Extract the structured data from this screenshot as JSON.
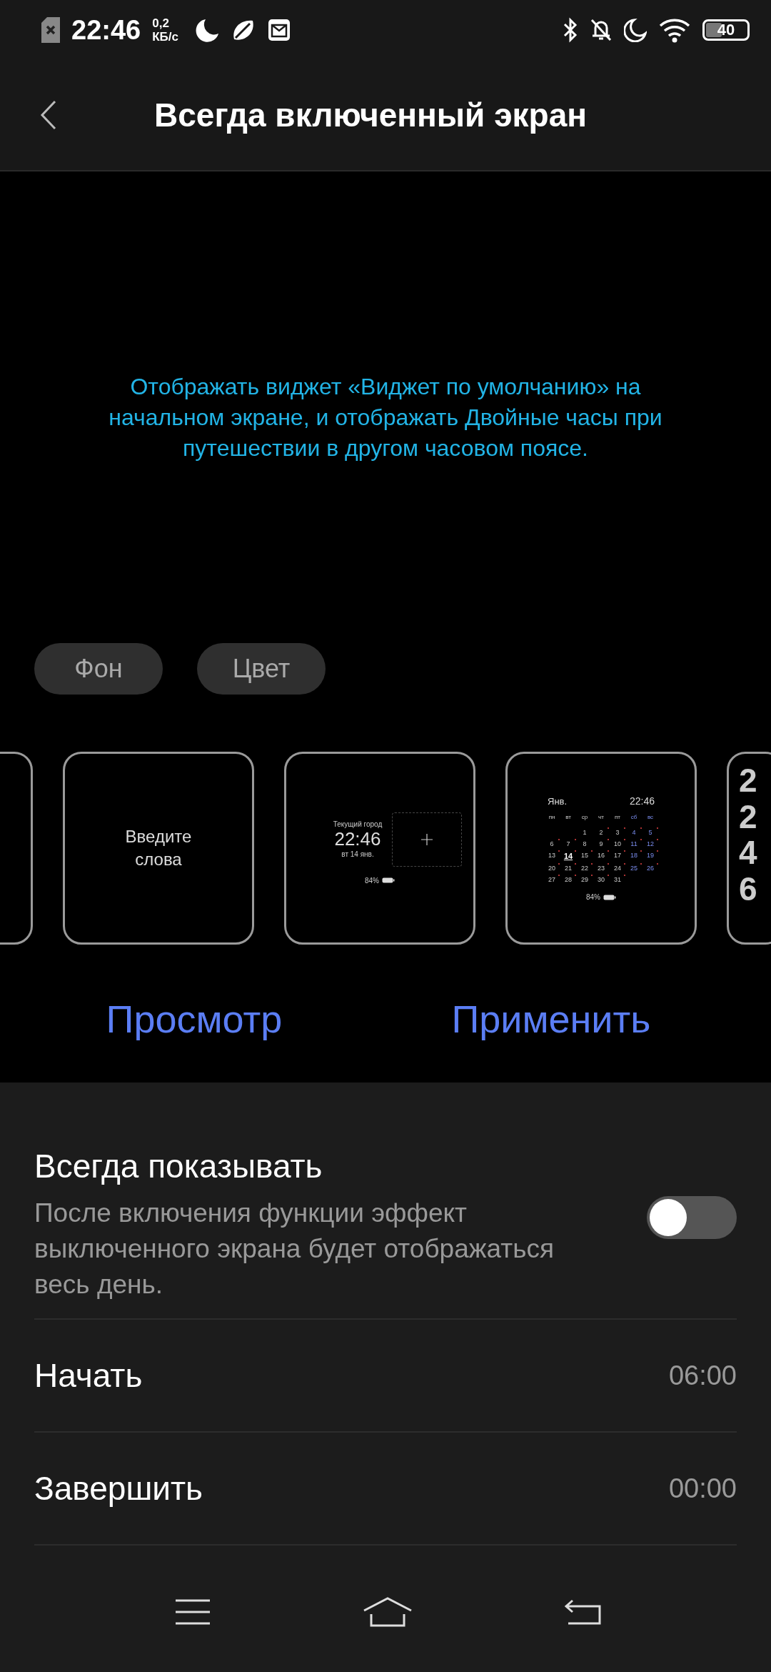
{
  "status_bar": {
    "time": "22:46",
    "speed_value": "0,2",
    "speed_unit": "КБ/с",
    "battery": "40"
  },
  "header": {
    "title": "Всегда включенный экран"
  },
  "preview": {
    "description": "Отображать виджет «Виджет по умолчанию» на начальном экране, и отображать Двойные часы при путешествии в другом часовом поясе."
  },
  "chips": [
    {
      "label": "Фон"
    },
    {
      "label": "Цвет"
    }
  ],
  "cards": [
    {
      "kind": "blank"
    },
    {
      "kind": "text",
      "text": "Введите слова"
    },
    {
      "kind": "dual_clock",
      "city": "Текущий город",
      "time": "22:46",
      "date": "вт 14 янв.",
      "battery": "84%"
    },
    {
      "kind": "calendar",
      "month": "Янв.",
      "time": "22:46",
      "battery": "84%",
      "weekdays": [
        {
          "label": "пн",
          "weekend": false
        },
        {
          "label": "вт",
          "weekend": false
        },
        {
          "label": "ср",
          "weekend": false
        },
        {
          "label": "чт",
          "weekend": false
        },
        {
          "label": "пт",
          "weekend": false
        },
        {
          "label": "сб",
          "weekend": true
        },
        {
          "label": "вс",
          "weekend": true
        }
      ],
      "days": [
        {
          "day": "1",
          "dot": false,
          "today": false
        },
        {
          "day": "2",
          "dot": true,
          "today": false
        },
        {
          "day": "3",
          "dot": true,
          "today": false
        },
        {
          "day": "4",
          "dot": true,
          "today": false
        },
        {
          "day": "5",
          "dot": true,
          "today": false
        },
        {
          "day": "6",
          "dot": true,
          "today": false
        },
        {
          "day": "7",
          "dot": true,
          "today": false
        },
        {
          "day": "8",
          "dot": false,
          "today": false
        },
        {
          "day": "9",
          "dot": true,
          "today": false
        },
        {
          "day": "10",
          "dot": true,
          "today": false
        },
        {
          "day": "11",
          "dot": true,
          "today": false
        },
        {
          "day": "12",
          "dot": true,
          "today": false
        },
        {
          "day": "13",
          "dot": true,
          "today": false
        },
        {
          "day": "14",
          "dot": true,
          "today": true
        },
        {
          "day": "15",
          "dot": true,
          "today": false
        },
        {
          "day": "16",
          "dot": true,
          "today": false
        },
        {
          "day": "17",
          "dot": true,
          "today": false
        },
        {
          "day": "18",
          "dot": true,
          "today": false
        },
        {
          "day": "19",
          "dot": true,
          "today": false
        },
        {
          "day": "20",
          "dot": true,
          "today": false
        },
        {
          "day": "21",
          "dot": true,
          "today": false
        },
        {
          "day": "22",
          "dot": true,
          "today": false
        },
        {
          "day": "23",
          "dot": true,
          "today": false
        },
        {
          "day": "24",
          "dot": true,
          "today": false
        },
        {
          "day": "25",
          "dot": true,
          "today": false
        },
        {
          "day": "26",
          "dot": true,
          "today": false
        },
        {
          "day": "27",
          "dot": true,
          "today": false
        },
        {
          "day": "28",
          "dot": true,
          "today": false
        },
        {
          "day": "29",
          "dot": true,
          "today": false
        },
        {
          "day": "30",
          "dot": true,
          "today": false
        },
        {
          "day": "31",
          "dot": true,
          "today": false
        }
      ]
    },
    {
      "kind": "digits",
      "text": "2246"
    }
  ],
  "actions": [
    {
      "label": "Просмотр"
    },
    {
      "label": "Применить"
    }
  ],
  "always_show": {
    "title": "Всегда показывать",
    "description": "После включения функции эффект выключенного экрана будет отображаться весь день.",
    "on": false
  },
  "settings": [
    {
      "label": "Начать",
      "value": "06:00"
    },
    {
      "label": "Завершить",
      "value": "00:00"
    }
  ]
}
